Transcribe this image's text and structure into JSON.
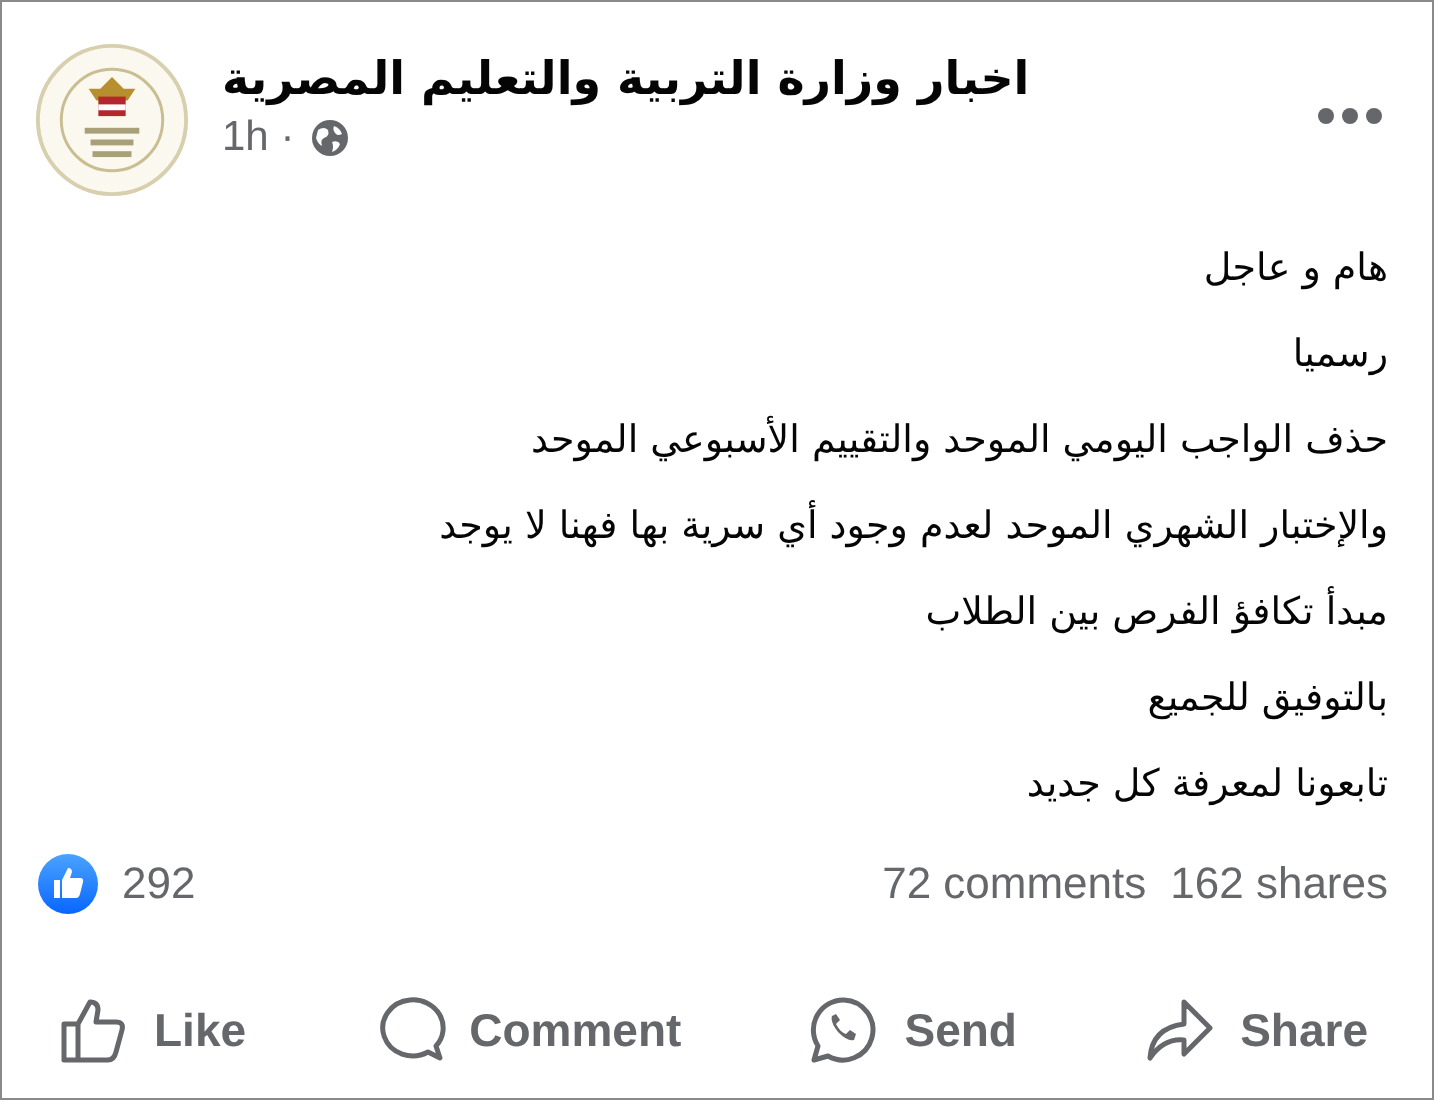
{
  "post": {
    "author": "اخبار وزارة التربية والتعليم المصرية",
    "time": "1h ·",
    "lines": [
      "هام و عاجل",
      "رسميا",
      "حذف  الواجب اليومي الموحد والتقييم الأسبوعي الموحد",
      "والإختبار الشهري الموحد لعدم وجود أي سرية بها فهنا لا يوجد",
      "مبدأ تكافؤ الفرص بين الطلاب",
      "بالتوفيق للجميع",
      "تابعونا لمعرفة كل جديد"
    ],
    "reactions": "292",
    "comments": "72 comments",
    "shares": "162 shares"
  },
  "action_bar": {
    "like": "Like",
    "comment": "Comment",
    "send": "Send",
    "share": "Share"
  }
}
